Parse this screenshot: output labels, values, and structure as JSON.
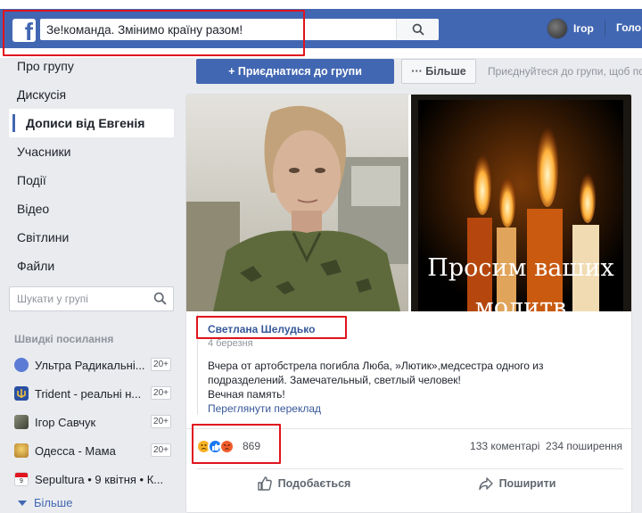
{
  "topbar": {
    "logo": "f",
    "search_value": "Зе!команда. Змінимо країну разом!",
    "user_name": "Ігор",
    "home_label": "Голо"
  },
  "nav": {
    "items": [
      {
        "label": "Про групу",
        "active": false
      },
      {
        "label": "Дискусія",
        "active": false
      },
      {
        "label": "Дописи від Евгенія",
        "active": true
      },
      {
        "label": "Учасники",
        "active": false
      },
      {
        "label": "Події",
        "active": false
      },
      {
        "label": "Відео",
        "active": false
      },
      {
        "label": "Світлини",
        "active": false
      },
      {
        "label": "Файли",
        "active": false
      }
    ]
  },
  "group_search": {
    "placeholder": "Шукати у групі"
  },
  "shortcuts": {
    "title": "Швидкі посилання",
    "items": [
      {
        "label": "Ультра Радикальні...",
        "badge": "20+",
        "color": "#5b7bd5"
      },
      {
        "label": "Trident - реальні н...",
        "badge": "20+",
        "color": "#f2c13a"
      },
      {
        "label": "Ігор Савчук",
        "badge": "20+",
        "color": "#6b6b6b"
      },
      {
        "label": "Одесса - Мама",
        "badge": "20+",
        "color": "#e2b04a"
      },
      {
        "label": "Sepultura • 9 квітня • К...",
        "badge": "",
        "color": "#d9dde3"
      }
    ],
    "more_label": "Більше"
  },
  "actions": {
    "join_label": "+ Приєднатися до групи",
    "more_label": "··· Більше",
    "hint": "Приєднуйтеся до групи, щоб по"
  },
  "post": {
    "image2_caption_line1": "Просим ваших",
    "image2_caption_line2": "молитв",
    "author": "Светлана Шелудько",
    "date": "4 березня",
    "text_line1": "Вчера от артобстрела погибла Люба, »Лютик»,медсестра одного из",
    "text_line2": "подразделений. Замечательный, светлый человек!",
    "text_line3": "Вечная память!",
    "translate_label": "Переглянути переклад",
    "reaction_count": "869",
    "comments": "133 коментарі",
    "shares": "234 поширення",
    "like_label": "Подобається",
    "share_label": "Поширити"
  },
  "colors": {
    "brand": "#4267b2",
    "highlight": "#e0141e",
    "link": "#365899"
  }
}
